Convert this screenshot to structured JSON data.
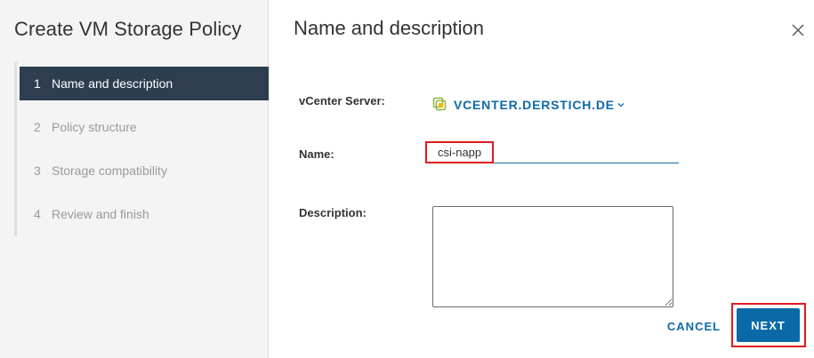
{
  "wizard": {
    "title": "Create VM Storage Policy",
    "steps": [
      {
        "number": "1",
        "label": "Name and description",
        "active": true
      },
      {
        "number": "2",
        "label": "Policy structure",
        "active": false
      },
      {
        "number": "3",
        "label": "Storage compatibility",
        "active": false
      },
      {
        "number": "4",
        "label": "Review and finish",
        "active": false
      }
    ]
  },
  "page": {
    "title": "Name and description",
    "close_icon": "close-icon"
  },
  "form": {
    "vcenter_label": "vCenter Server:",
    "vcenter_value": "VCENTER.DERSTICH.DE",
    "vcenter_icon": "vcenter-icon",
    "name_label": "Name:",
    "name_value": "csi-napp",
    "description_label": "Description:",
    "description_value": ""
  },
  "footer": {
    "cancel_label": "CANCEL",
    "next_label": "NEXT"
  },
  "colors": {
    "accent": "#0a6aa8",
    "active_step_bg": "#2c3e50",
    "highlight": "#e0191f",
    "vcenter_icon": "#8cb63c"
  }
}
